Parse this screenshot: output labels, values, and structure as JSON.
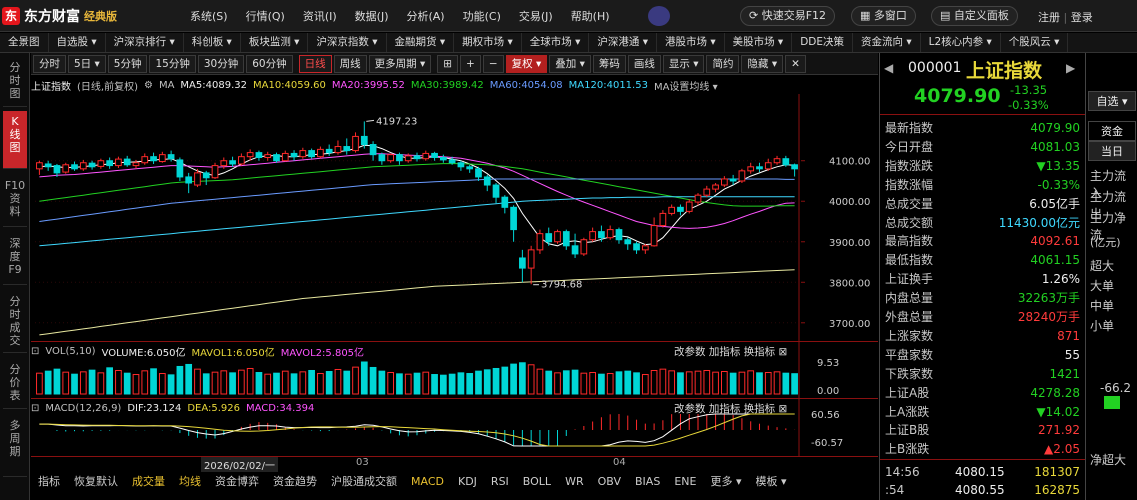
{
  "app": {
    "name": "东方财富",
    "edition": "经典版"
  },
  "menu": [
    "系统(S)",
    "行情(Q)",
    "资讯(I)",
    "数据(J)",
    "分析(A)",
    "功能(C)",
    "交易(J)",
    "帮助(H)"
  ],
  "top_buttons": {
    "quick_trade": "快速交易F12",
    "multi_window": "多窗口",
    "custom_panel": "自定义面板",
    "register": "注册",
    "login": "登录"
  },
  "nav": [
    "全景图",
    "自选股 ▾",
    "沪深京排行 ▾",
    "科创板 ▾",
    "板块监测 ▾",
    "沪深京指数 ▾",
    "金融期货 ▾",
    "期权市场 ▾",
    "全球市场 ▾",
    "沪深港通 ▾",
    "港股市场 ▾",
    "美股市场 ▾",
    "DDE决策",
    "资金流向 ▾",
    "L2核心内参 ▾",
    "个股风云 ▾"
  ],
  "left_tabs": [
    {
      "label": "分时图",
      "active": false
    },
    {
      "label": "K线图",
      "active": true
    },
    {
      "label": "F10资料",
      "active": false
    },
    {
      "label": "深度F9",
      "active": false
    },
    {
      "label": "分时成交",
      "active": false
    },
    {
      "label": "分价表",
      "active": false
    },
    {
      "label": "多周期",
      "active": false
    }
  ],
  "periods": [
    "分时",
    "5日 ▾",
    "5分钟",
    "15分钟",
    "30分钟",
    "60分钟",
    "日线",
    "周线",
    "更多周期 ▾"
  ],
  "active_period": "日线",
  "tools": {
    "adjust": "复权 ▾",
    "overlay": "叠加 ▾",
    "chips": "筹码",
    "draw": "画线",
    "display": "显示 ▾",
    "simple": "简约",
    "hide": "隐藏 ▾"
  },
  "main_header": {
    "title": "上证指数",
    "mode": "(日线,前复权)",
    "ma": "MA",
    "ma5": "MA5:4089.32",
    "ma10": "MA10:4059.60",
    "ma20": "MA20:3995.52",
    "ma30": "MA30:3989.42",
    "ma60": "MA60:4054.08",
    "ma120": "MA120:4011.53",
    "ma_settings": "MA设置均线 ▾"
  },
  "price_axis": [
    "4100.00",
    "4000.00",
    "3900.00",
    "3800.00",
    "3700.00"
  ],
  "annotations": {
    "high": "4197.23",
    "low": "3794.68"
  },
  "vol_header": {
    "name": "VOL(5,10)",
    "volume": "VOLUME:6.050亿",
    "mavol1": "MAVOL1:6.050亿",
    "mavol2": "MAVOL2:5.805亿"
  },
  "vol_axis": [
    "9.53",
    "0.00"
  ],
  "macd_header": {
    "name": "MACD(12,26,9)",
    "dif": "DIF:23.124",
    "dea": "DEA:5.926",
    "macd": "MACD:34.394"
  },
  "macd_axis": [
    "60.56",
    "-60.57"
  ],
  "sub_controls": {
    "params": "改参数",
    "add": "加指标",
    "swap": "换指标"
  },
  "x_axis": {
    "date": "2026/02/02/一",
    "m1": "03",
    "m2": "04"
  },
  "bottom_tabs": [
    "指标",
    "恢复默认",
    "成交量",
    "均线",
    "资金博弈",
    "资金趋势",
    "沪股通成交额",
    "MACD",
    "KDJ",
    "RSI",
    "BOLL",
    "WR",
    "OBV",
    "BIAS",
    "ENE",
    "更多 ▾",
    "模板 ▾"
  ],
  "quote": {
    "code": "000001",
    "name": "上证指数",
    "price": "4079.90",
    "change": "-13.35",
    "change_pct": "-0.33%",
    "watch_btn": "自选 ▾",
    "rows": [
      {
        "k": "最新指数",
        "v": "4079.90",
        "c": "green"
      },
      {
        "k": "今日开盘",
        "v": "4081.03",
        "c": "green"
      },
      {
        "k": "指数涨跌",
        "v": "▼13.35",
        "c": "green"
      },
      {
        "k": "指数涨幅",
        "v": "-0.33%",
        "c": "green"
      },
      {
        "k": "总成交量",
        "v": "6.05亿手",
        "c": "white"
      },
      {
        "k": "总成交额",
        "v": "11430.00亿元",
        "c": "cyan"
      },
      {
        "k": "最高指数",
        "v": "4092.61",
        "c": "red"
      },
      {
        "k": "最低指数",
        "v": "4061.15",
        "c": "green"
      },
      {
        "k": "上证换手",
        "v": "1.26%",
        "c": "white"
      },
      {
        "k": "内盘总量",
        "v": "32263万手",
        "c": "green"
      },
      {
        "k": "外盘总量",
        "v": "28240万手",
        "c": "red"
      },
      {
        "k": "上涨家数",
        "v": "871",
        "c": "red"
      },
      {
        "k": "平盘家数",
        "v": "55",
        "c": "white"
      },
      {
        "k": "下跌家数",
        "v": "1421",
        "c": "green"
      },
      {
        "k": "上证A股",
        "v": "4278.28",
        "c": "green"
      },
      {
        "k": "上A涨跌",
        "v": "▼14.02",
        "c": "green"
      },
      {
        "k": "上证B股",
        "v": "271.92",
        "c": "red"
      },
      {
        "k": "上B涨跌",
        "v": "▲2.05",
        "c": "red"
      }
    ],
    "ticks": [
      {
        "t": "14:56",
        "p": "4080.15",
        "v": "181307"
      },
      {
        "t": ":54",
        "p": "4080.55",
        "v": "162875"
      }
    ]
  },
  "fund_panel": {
    "tab1": "资金",
    "tab2": "当日",
    "rows": [
      "主力流入",
      "主力流出",
      "主力净流"
    ],
    "unit": "(亿元)",
    "sizes": [
      "超大",
      "大单",
      "中单",
      "小单"
    ],
    "value": "-66.2",
    "net": "净超大"
  },
  "colors": {
    "red": "#ff3b3b",
    "green": "#22d122",
    "cyan": "#3fd9ff",
    "up_bar": "#ff2a2a",
    "down_bar": "#00d6d6",
    "ma5": "#ffffff",
    "ma10": "#e8d83a",
    "ma20": "#ff55ff",
    "ma30": "#22d122",
    "ma60": "#6a9bff",
    "ma120": "#3fd9ff"
  },
  "chart_data": {
    "type": "candlestick",
    "ylim": [
      3660,
      4240
    ],
    "title": "上证指数",
    "candles_note": "",
    "candles": [
      [
        4080,
        4095,
        4065,
        4100
      ],
      [
        4092,
        4085,
        4075,
        4100
      ],
      [
        4088,
        4070,
        4060,
        4092
      ],
      [
        4072,
        4090,
        4068,
        4095
      ],
      [
        4090,
        4080,
        4075,
        4098
      ],
      [
        4080,
        4095,
        4075,
        4102
      ],
      [
        4094,
        4085,
        4078,
        4100
      ],
      [
        4086,
        4100,
        4080,
        4105
      ],
      [
        4100,
        4088,
        4080,
        4108
      ],
      [
        4088,
        4104,
        4082,
        4110
      ],
      [
        4104,
        4090,
        4085,
        4112
      ],
      [
        4088,
        4095,
        4080,
        4102
      ],
      [
        4095,
        4110,
        4090,
        4118
      ],
      [
        4110,
        4100,
        4092,
        4120
      ],
      [
        4098,
        4115,
        4095,
        4122
      ],
      [
        4115,
        4105,
        4098,
        4125
      ],
      [
        4102,
        4060,
        4050,
        4108
      ],
      [
        4060,
        4045,
        4020,
        4070
      ],
      [
        4040,
        4070,
        4035,
        4080
      ],
      [
        4070,
        4058,
        4040,
        4075
      ],
      [
        4058,
        4088,
        4055,
        4095
      ],
      [
        4088,
        4100,
        4080,
        4108
      ],
      [
        4100,
        4092,
        4085,
        4110
      ],
      [
        4092,
        4110,
        4088,
        4118
      ],
      [
        4110,
        4120,
        4100,
        4128
      ],
      [
        4120,
        4108,
        4100,
        4125
      ],
      [
        4108,
        4115,
        4100,
        4122
      ],
      [
        4115,
        4100,
        4095,
        4120
      ],
      [
        4100,
        4118,
        4098,
        4125
      ],
      [
        4118,
        4110,
        4100,
        4126
      ],
      [
        4110,
        4125,
        4105,
        4132
      ],
      [
        4125,
        4110,
        4105,
        4130
      ],
      [
        4110,
        4128,
        4106,
        4135
      ],
      [
        4128,
        4120,
        4112,
        4140
      ],
      [
        4120,
        4135,
        4115,
        4150
      ],
      [
        4135,
        4125,
        4115,
        4155
      ],
      [
        4125,
        4160,
        4120,
        4170
      ],
      [
        4160,
        4140,
        4130,
        4197
      ],
      [
        4140,
        4115,
        4100,
        4148
      ],
      [
        4115,
        4100,
        4090,
        4120
      ],
      [
        4100,
        4115,
        4095,
        4118
      ],
      [
        4115,
        4100,
        4090,
        4120
      ],
      [
        4100,
        4112,
        4095,
        4118
      ],
      [
        4112,
        4105,
        4098,
        4120
      ],
      [
        4105,
        4118,
        4100,
        4125
      ],
      [
        4118,
        4108,
        4100,
        4122
      ],
      [
        4108,
        4102,
        4095,
        4115
      ],
      [
        4102,
        4095,
        4090,
        4110
      ],
      [
        4095,
        4085,
        4075,
        4100
      ],
      [
        4085,
        4080,
        4070,
        4090
      ],
      [
        4080,
        4060,
        4050,
        4085
      ],
      [
        4060,
        4040,
        4025,
        4065
      ],
      [
        4040,
        4010,
        3995,
        4045
      ],
      [
        4010,
        3985,
        3970,
        4015
      ],
      [
        3985,
        3930,
        3900,
        3990
      ],
      [
        3860,
        3835,
        3800,
        3880
      ],
      [
        3835,
        3880,
        3795,
        3890
      ],
      [
        3880,
        3920,
        3870,
        3930
      ],
      [
        3920,
        3900,
        3890,
        3935
      ],
      [
        3900,
        3925,
        3895,
        3930
      ],
      [
        3925,
        3890,
        3880,
        3930
      ],
      [
        3890,
        3870,
        3860,
        3920
      ],
      [
        3870,
        3905,
        3865,
        3910
      ],
      [
        3905,
        3925,
        3900,
        3935
      ],
      [
        3925,
        3910,
        3900,
        3940
      ],
      [
        3910,
        3930,
        3905,
        3940
      ],
      [
        3930,
        3905,
        3895,
        3935
      ],
      [
        3905,
        3895,
        3880,
        3910
      ],
      [
        3895,
        3880,
        3870,
        3900
      ],
      [
        3880,
        3890,
        3870,
        3895
      ],
      [
        3890,
        3940,
        3888,
        3960
      ],
      [
        3940,
        3970,
        3935,
        3978
      ],
      [
        3970,
        3985,
        3965,
        3992
      ],
      [
        3985,
        3975,
        3965,
        3992
      ],
      [
        3975,
        3998,
        3970,
        4005
      ],
      [
        3998,
        4015,
        3990,
        4020
      ],
      [
        4015,
        4030,
        4010,
        4038
      ],
      [
        4030,
        4040,
        4022,
        4045
      ],
      [
        4040,
        4055,
        4035,
        4062
      ],
      [
        4055,
        4050,
        4040,
        4065
      ],
      [
        4050,
        4075,
        4045,
        4080
      ],
      [
        4075,
        4085,
        4068,
        4095
      ],
      [
        4085,
        4080,
        4072,
        4095
      ],
      [
        4080,
        4095,
        4075,
        4105
      ],
      [
        4095,
        4105,
        4090,
        4112
      ],
      [
        4105,
        4090,
        4085,
        4112
      ],
      [
        4090,
        4080,
        4061,
        4093
      ]
    ],
    "ma": {
      "ma5": [
        4085,
        4087,
        4085,
        4083,
        4084,
        4085,
        4088,
        4090,
        4092,
        4095,
        4096,
        4097,
        4099,
        4102,
        4103,
        4105,
        4096,
        4085,
        4075,
        4068,
        4063,
        4070,
        4080,
        4092,
        4102,
        4110,
        4112,
        4113,
        4110,
        4110,
        4112,
        4115,
        4116,
        4118,
        4122,
        4125,
        4130,
        4138,
        4137,
        4130,
        4120,
        4112,
        4106,
        4106,
        4108,
        4110,
        4108,
        4104,
        4100,
        4092,
        4082,
        4068,
        4051,
        4032,
        4007,
        3970,
        3940,
        3910,
        3895,
        3890,
        3900,
        3902,
        3898,
        3900,
        3906,
        3912,
        3915,
        3912,
        3902,
        3893,
        3895,
        3910,
        3935,
        3960,
        3980,
        3990,
        4000,
        4015,
        4030,
        4040,
        4052,
        4062,
        4070,
        4078,
        4085,
        4090,
        4089
      ],
      "ma20": [
        4060,
        4062,
        4064,
        4065,
        4066,
        4068,
        4070,
        4072,
        4074,
        4076,
        4078,
        4080,
        4082,
        4084,
        4086,
        4088,
        4088,
        4087,
        4086,
        4085,
        4084,
        4085,
        4086,
        4088,
        4090,
        4092,
        4094,
        4096,
        4098,
        4100,
        4102,
        4104,
        4106,
        4108,
        4110,
        4112,
        4114,
        4116,
        4117,
        4117,
        4116,
        4115,
        4114,
        4113,
        4112,
        4111,
        4110,
        4108,
        4106,
        4102,
        4098,
        4094,
        4088,
        4082,
        4074,
        4064,
        4054,
        4044,
        4034,
        4024,
        4015,
        4006,
        3998,
        3990,
        3982,
        3974,
        3966,
        3958,
        3950,
        3945,
        3940,
        3938,
        3936,
        3934,
        3933,
        3934,
        3936,
        3940,
        3945,
        3952,
        3960,
        3968,
        3975,
        3983,
        3990,
        3995,
        3996
      ],
      "ma30": [
        4000,
        4003,
        4006,
        4009,
        4012,
        4015,
        4018,
        4021,
        4024,
        4027,
        4030,
        4033,
        4036,
        4039,
        4042,
        4045,
        4047,
        4048,
        4049,
        4050,
        4051,
        4052,
        4053,
        4055,
        4057,
        4059,
        4061,
        4063,
        4065,
        4067,
        4069,
        4071,
        4073,
        4075,
        4077,
        4079,
        4081,
        4083,
        4085,
        4086,
        4087,
        4088,
        4089,
        4090,
        4091,
        4092,
        4093,
        4093,
        4093,
        4092,
        4091,
        4090,
        4088,
        4086,
        4083,
        4080,
        4076,
        4072,
        4068,
        4064,
        4060,
        4056,
        4052,
        4048,
        4044,
        4040,
        4036,
        4032,
        4028,
        4024,
        4020,
        4016,
        4012,
        4008,
        4004,
        4000,
        3997,
        3994,
        3991,
        3989,
        3988,
        3988,
        3988,
        3988,
        3989,
        3989,
        3989
      ],
      "ma60": [
        3950,
        3953,
        3956,
        3959,
        3962,
        3965,
        3968,
        3971,
        3974,
        3977,
        3980,
        3983,
        3986,
        3989,
        3992,
        3995,
        3997,
        3999,
        4001,
        4003,
        4005,
        4007,
        4009,
        4011,
        4013,
        4015,
        4017,
        4019,
        4021,
        4023,
        4025,
        4027,
        4029,
        4031,
        4033,
        4035,
        4037,
        4039,
        4041,
        4042,
        4043,
        4044,
        4045,
        4046,
        4047,
        4048,
        4049,
        4050,
        4051,
        4052,
        4053,
        4054,
        4055,
        4055,
        4055,
        4055,
        4055,
        4055,
        4055,
        4055,
        4055,
        4055,
        4055,
        4055,
        4055,
        4055,
        4055,
        4055,
        4055,
        4055,
        4055,
        4055,
        4055,
        4055,
        4055,
        4055,
        4055,
        4055,
        4055,
        4055,
        4055,
        4055,
        4055,
        4055,
        4055,
        4054,
        4054
      ],
      "ma120": [
        3890,
        3892,
        3894,
        3896,
        3898,
        3900,
        3902,
        3904,
        3906,
        3908,
        3910,
        3912,
        3914,
        3916,
        3918,
        3920,
        3922,
        3924,
        3926,
        3928,
        3930,
        3932,
        3934,
        3936,
        3938,
        3940,
        3942,
        3944,
        3946,
        3948,
        3950,
        3952,
        3954,
        3956,
        3958,
        3960,
        3962,
        3964,
        3966,
        3968,
        3970,
        3972,
        3974,
        3976,
        3978,
        3980,
        3982,
        3984,
        3986,
        3988,
        3990,
        3992,
        3994,
        3996,
        3998,
        4000,
        4001,
        4002,
        4003,
        4004,
        4005,
        4006,
        4007,
        4008,
        4008,
        4009,
        4009,
        4010,
        4010,
        4010,
        4010,
        4011,
        4011,
        4011,
        4011,
        4011,
        4011,
        4011,
        4011,
        4011,
        4011,
        4011,
        4011,
        4011,
        4011,
        4011,
        4011
      ],
      "ma250": [
        3670,
        3673,
        3676,
        3679,
        3682,
        3685,
        3688,
        3691,
        3694,
        3697,
        3700,
        3703,
        3706,
        3709,
        3712,
        3715,
        3718,
        3721,
        3724,
        3727,
        3730,
        3733,
        3736,
        3739,
        3742,
        3745,
        3748,
        3751,
        3754,
        3757,
        3760,
        3762,
        3764,
        3766,
        3768,
        3770,
        3772,
        3774,
        3776,
        3778,
        3780,
        3782,
        3784,
        3786,
        3788,
        3790,
        3791,
        3792,
        3793,
        3794,
        3795,
        3796,
        3797,
        3798,
        3799,
        3800,
        3801,
        3802,
        3803,
        3804,
        3805,
        3806,
        3807,
        3808,
        3809,
        3810,
        3811,
        3812,
        3813,
        3814,
        3815,
        3816,
        3817,
        3818,
        3819,
        3820,
        3821,
        3822,
        3823,
        3824,
        3825,
        3826,
        3827,
        3828,
        3829,
        3830,
        3831
      ]
    },
    "volume": [
      6.2,
      6.8,
      7.4,
      6.5,
      5.9,
      6.6,
      7.1,
      6.3,
      7.8,
      7.0,
      6.2,
      5.8,
      6.9,
      7.5,
      6.1,
      5.7,
      8.2,
      8.8,
      7.4,
      6.0,
      6.5,
      6.9,
      6.3,
      7.1,
      7.6,
      6.4,
      5.9,
      6.2,
      6.8,
      6.0,
      6.6,
      7.0,
      6.1,
      6.7,
      7.3,
      6.8,
      8.0,
      9.53,
      7.9,
      6.8,
      6.4,
      6.0,
      5.9,
      6.2,
      6.5,
      5.8,
      5.6,
      5.9,
      6.3,
      6.1,
      6.8,
      7.2,
      7.6,
      8.0,
      8.9,
      9.3,
      8.7,
      7.4,
      6.8,
      6.3,
      6.9,
      7.1,
      6.2,
      6.4,
      5.9,
      6.1,
      6.6,
      6.8,
      6.3,
      5.8,
      7.0,
      7.4,
      6.9,
      6.3,
      6.6,
      6.8,
      7.0,
      6.5,
      6.7,
      6.2,
      6.5,
      6.9,
      6.3,
      6.4,
      6.6,
      6.2,
      6.05
    ],
    "volume_ylim": [
      0,
      9.53
    ],
    "macd_ylim": [
      -60.57,
      60.56
    ]
  }
}
